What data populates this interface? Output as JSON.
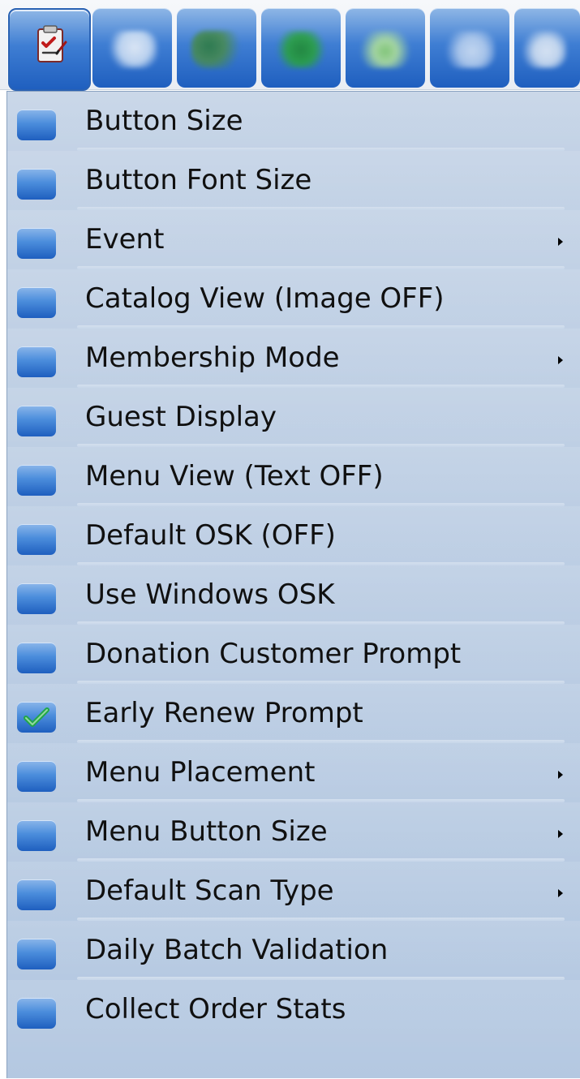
{
  "menu": {
    "items": [
      {
        "label": "Button Size",
        "submenu": false,
        "checked": false
      },
      {
        "label": "Button Font Size",
        "submenu": false,
        "checked": false
      },
      {
        "label": "Event",
        "submenu": true,
        "checked": false
      },
      {
        "label": "Catalog View (Image OFF)",
        "submenu": false,
        "checked": false
      },
      {
        "label": "Membership Mode",
        "submenu": true,
        "checked": false
      },
      {
        "label": "Guest Display",
        "submenu": false,
        "checked": false
      },
      {
        "label": "Menu View (Text OFF)",
        "submenu": false,
        "checked": false
      },
      {
        "label": "Default OSK (OFF)",
        "submenu": false,
        "checked": false
      },
      {
        "label": "Use Windows OSK",
        "submenu": false,
        "checked": false
      },
      {
        "label": "Donation Customer Prompt",
        "submenu": false,
        "checked": false
      },
      {
        "label": "Early Renew Prompt",
        "submenu": false,
        "checked": true
      },
      {
        "label": "Menu Placement",
        "submenu": true,
        "checked": false
      },
      {
        "label": "Menu Button Size",
        "submenu": true,
        "checked": false
      },
      {
        "label": "Default Scan Type",
        "submenu": true,
        "checked": false
      },
      {
        "label": "Daily Batch Validation",
        "submenu": false,
        "checked": false
      },
      {
        "label": "Collect Order Stats",
        "submenu": false,
        "checked": false
      }
    ]
  },
  "toolbar": {
    "buttons": [
      {
        "icon": "checklist-icon",
        "active": true,
        "accent": "#2a62b3"
      },
      {
        "icon": "blurred-icon",
        "active": false,
        "accent": "#e9eef7"
      },
      {
        "icon": "blurred-icon",
        "active": false,
        "accent": "#2b7a3b"
      },
      {
        "icon": "blurred-icon",
        "active": false,
        "accent": "#1f8a2a"
      },
      {
        "icon": "blurred-icon",
        "active": false,
        "accent": "#8ed26a"
      },
      {
        "icon": "blurred-icon",
        "active": false,
        "accent": "#d9e6f6"
      },
      {
        "icon": "blurred-icon",
        "active": false,
        "accent": "#f0f4f8"
      }
    ]
  },
  "colors": {
    "menu_bg": "#b4c8e1",
    "icon_blue": "#1f5fbf",
    "check_green": "#22a64a"
  }
}
